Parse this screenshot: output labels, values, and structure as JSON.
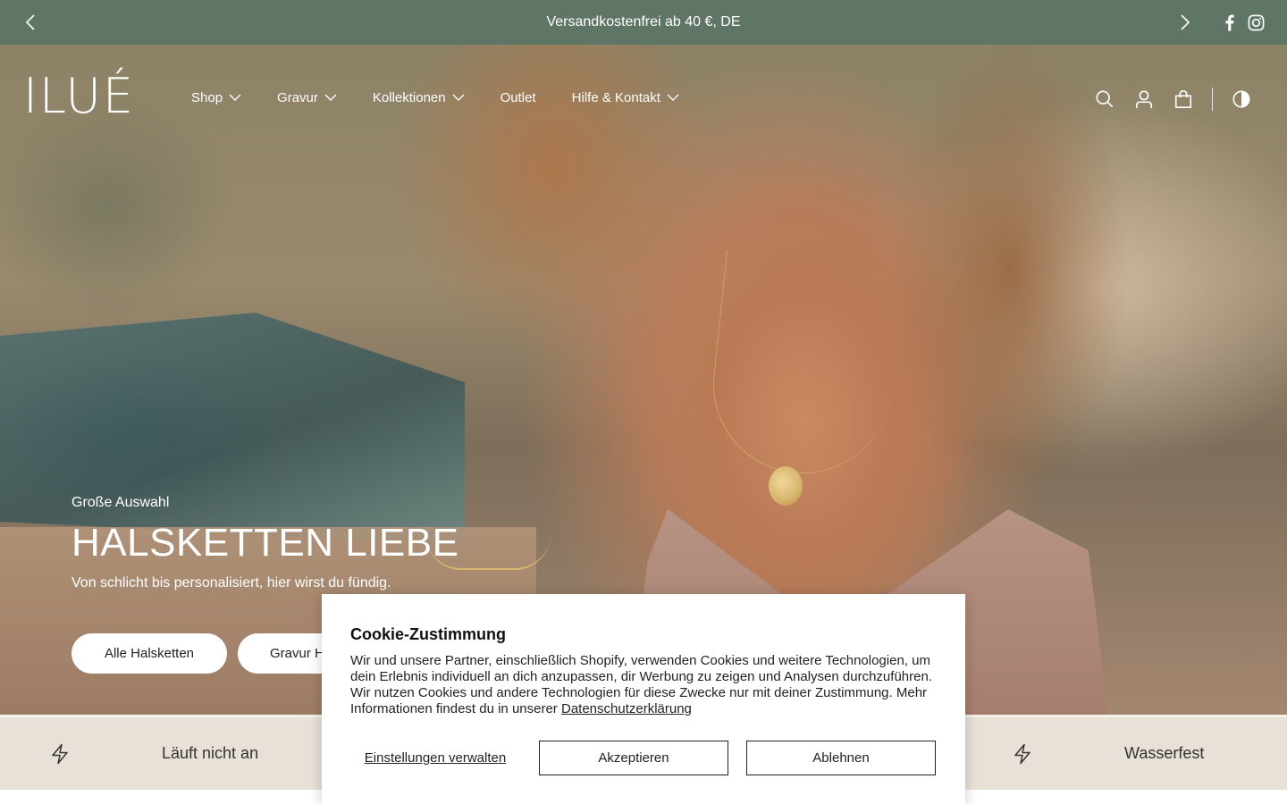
{
  "announcement": {
    "message": "Versandkostenfrei ab 40 €, DE",
    "prev_icon": "chevron-left-icon",
    "next_icon": "chevron-right-icon",
    "social": [
      "facebook-icon",
      "instagram-icon"
    ]
  },
  "header": {
    "logo": "ILUÉ",
    "nav": [
      {
        "label": "Shop",
        "has_dropdown": true
      },
      {
        "label": "Gravur",
        "has_dropdown": true
      },
      {
        "label": "Kollektionen",
        "has_dropdown": true
      },
      {
        "label": "Outlet",
        "has_dropdown": false
      },
      {
        "label": "Hilfe & Kontakt",
        "has_dropdown": true
      }
    ],
    "icons": [
      "search-icon",
      "account-icon",
      "cart-icon",
      "contrast-icon"
    ]
  },
  "hero": {
    "eyebrow": "Große Auswahl",
    "title": "HALSKETTEN LIEBE",
    "subtitle": "Von schlicht bis personalisiert, hier wirst du fündig.",
    "buttons": [
      "Alle Halsketten",
      "Gravur H"
    ]
  },
  "usp": {
    "items": [
      {
        "icon": "bolt-icon",
        "label": "Läuft nicht an"
      },
      {
        "icon": "bolt-icon",
        "label": "Wasserfest"
      }
    ]
  },
  "cookie": {
    "title": "Cookie-Zustimmung",
    "text": "Wir und unsere Partner, einschließlich Shopify, verwenden Cookies und weitere Technologien, um dein Erlebnis individuell an dich anzupassen, dir Werbung zu zeigen und Analysen durchzuführen. Wir nutzen Cookies und andere Technologien für diese Zwecke nur mit deiner Zustimmung. Mehr Informationen findest du in unserer",
    "link": "Datenschutzerklärung",
    "manage": "Einstellungen verwalten",
    "accept": "Akzeptieren",
    "decline": "Ablehnen"
  },
  "colors": {
    "announcement_bg": "#5f7566",
    "usp_bg": "#e8e1d8",
    "hero_text": "#ffffff"
  }
}
